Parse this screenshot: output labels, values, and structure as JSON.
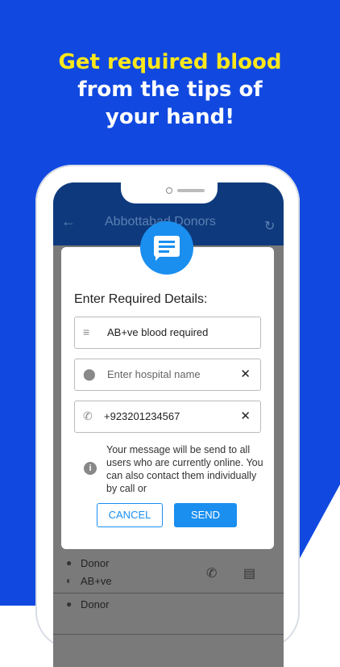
{
  "headline": {
    "line1": "Get required blood",
    "line2": "from the tips of",
    "line3": "your hand!"
  },
  "appbar": {
    "title": "Abbottabad Donors"
  },
  "dialog": {
    "title": "Enter Required Details:",
    "message_field": {
      "value": "AB+ve blood required"
    },
    "hospital_field": {
      "placeholder": "Enter hospital name"
    },
    "phone_field": {
      "value": "+923201234567"
    },
    "info_text": "Your message will be send to all users who are currently online. You can also contact them individually by call or",
    "cancel_label": "CANCEL",
    "send_label": "SEND"
  },
  "list": {
    "rows": [
      {
        "name": "Donor",
        "group": "AB+ve"
      },
      {
        "name": "Donor",
        "group": ""
      }
    ]
  },
  "colors": {
    "background": "#1149e0",
    "headline_accent": "#ffe81a",
    "primary": "#1a8ff0",
    "appbar": "#0e3a7d"
  }
}
